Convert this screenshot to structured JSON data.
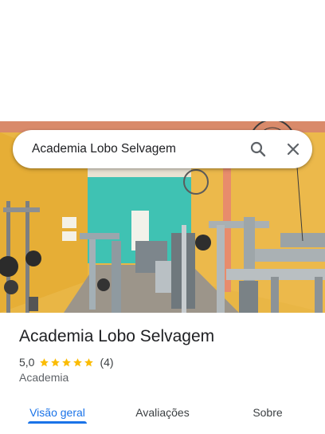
{
  "search": {
    "query": "Academia Lobo Selvagem",
    "search_icon": "search-icon",
    "close_icon": "close-icon"
  },
  "place": {
    "title": "Academia Lobo Selvagem",
    "rating": "5,0",
    "stars": 5,
    "reviews": "(4)",
    "category": "Academia"
  },
  "tabs": [
    {
      "label": "Visão geral",
      "active": true
    },
    {
      "label": "Avaliações",
      "active": false
    },
    {
      "label": "Sobre",
      "active": false
    }
  ],
  "colors": {
    "accent": "#1a73e8",
    "star": "#fbbc04",
    "wall_yellow": "#e7b53d",
    "wall_teal": "#3ec0b0"
  }
}
